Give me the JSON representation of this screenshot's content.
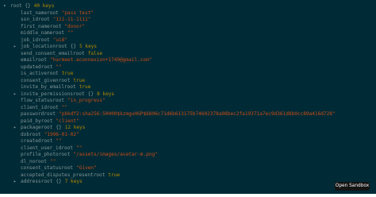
{
  "root": {
    "caret": "▾",
    "key": "root",
    "brace": "{}",
    "count": "40 keys"
  },
  "rows": [
    {
      "caret": "",
      "key": "last_name",
      "suffix": "root",
      "value": "\"pass test\"",
      "kind": "str"
    },
    {
      "caret": "",
      "key": "ssn_id",
      "suffix": "root",
      "value": "\"111-11-1111\"",
      "kind": "str"
    },
    {
      "caret": "",
      "key": "first_name",
      "suffix": "root",
      "value": "\"donor\"",
      "kind": "str"
    },
    {
      "caret": "",
      "key": "middle_name",
      "suffix": "root",
      "value": "\"\"",
      "kind": "str"
    },
    {
      "caret": "",
      "key": "job_id",
      "suffix": "root",
      "value": "\"ui8\"",
      "kind": "str"
    },
    {
      "caret": "▸",
      "key": "job_location",
      "suffix": "root",
      "brace": "{}",
      "count": "5 keys"
    },
    {
      "caret": "",
      "key": "send_consent_email",
      "suffix": "root",
      "value": "false",
      "kind": "bool"
    },
    {
      "caret": "",
      "key": "email",
      "suffix": "root",
      "value": "\"harmeet.aconnexion+1749@gmail.com\"",
      "kind": "str"
    },
    {
      "caret": "",
      "key": "updated",
      "suffix": "root",
      "value": "\"\"",
      "kind": "str"
    },
    {
      "caret": "",
      "key": "is_active",
      "suffix": "root",
      "value": "true",
      "kind": "bool"
    },
    {
      "caret": "",
      "key": "consent_given",
      "suffix": "root",
      "value": "true",
      "kind": "bool"
    },
    {
      "caret": "",
      "key": "invite_by_email",
      "suffix": "root",
      "value": "true",
      "kind": "bool"
    },
    {
      "caret": "▸",
      "key": "invite_permissions",
      "suffix": "root",
      "brace": "{}",
      "count": "8 keys"
    },
    {
      "caret": "",
      "key": "flow_status",
      "suffix": "root",
      "value": "\"in_progress\"",
      "kind": "str"
    },
    {
      "caret": "",
      "key": "client_id",
      "suffix": "root",
      "value": "\"\"",
      "kind": "str"
    },
    {
      "caret": "",
      "key": "password",
      "suffix": "root",
      "value": "\"pbkdf2:sha256:50000$kzmguHGP$6806c71d6b613175b74602378a08bec2fa19371a7ec9d361d8b0cc89a416d728\"",
      "kind": "str"
    },
    {
      "caret": "",
      "key": "paid_by",
      "suffix": "root",
      "value": "\"client\"",
      "kind": "str"
    },
    {
      "caret": "▸",
      "key": "package",
      "suffix": "root",
      "brace": "{}",
      "count": "12 keys"
    },
    {
      "caret": "",
      "key": "dob",
      "suffix": "root",
      "value": "\"1996-01-02\"",
      "kind": "str"
    },
    {
      "caret": "",
      "key": "created",
      "suffix": "root",
      "value": "\"\"",
      "kind": "str"
    },
    {
      "caret": "",
      "key": "client_user_id",
      "suffix": "root",
      "value": "\"\"",
      "kind": "str"
    },
    {
      "caret": "",
      "key": "profile_photo",
      "suffix": "root",
      "value": "\"/assets/images/avatar-m.png\"",
      "kind": "str"
    },
    {
      "caret": "",
      "key": "dl_no",
      "suffix": "root",
      "value": "\"\"",
      "kind": "str"
    },
    {
      "caret": "",
      "key": "consent_status",
      "suffix": "root",
      "value": "\"Given\"",
      "kind": "str"
    },
    {
      "caret": "",
      "key": "accepted_disputes_present",
      "suffix": "root",
      "value": "true",
      "kind": "bool"
    },
    {
      "caret": "▸",
      "key": "address",
      "suffix": "root",
      "brace": "{}",
      "count": "7 keys"
    }
  ],
  "sandbox_button": {
    "label": "Open Sandbox"
  },
  "colors": {
    "background": "#002b36",
    "key": "#839496",
    "string": "#cb4b16",
    "boolean": "#b58900"
  }
}
